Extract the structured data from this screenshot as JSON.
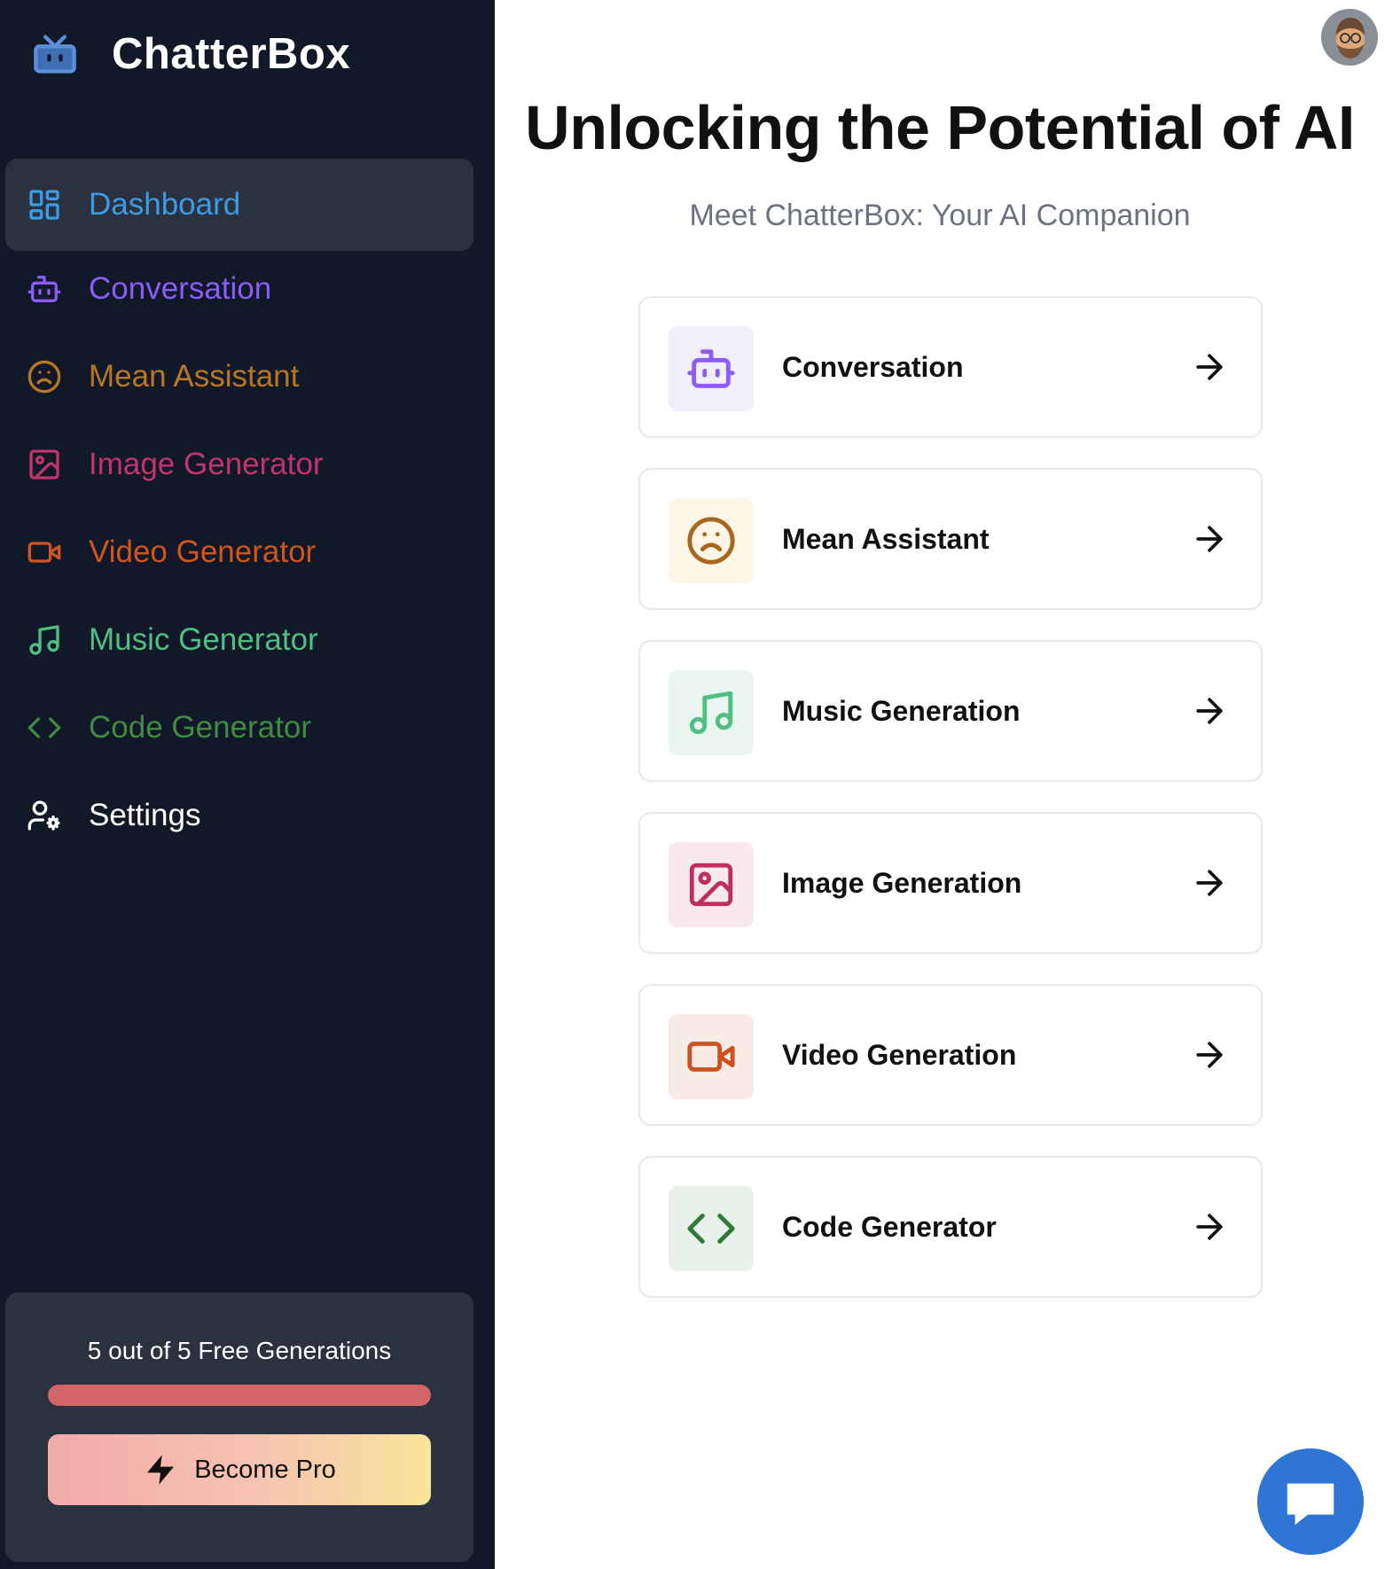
{
  "app": {
    "name": "ChatterBox"
  },
  "sidebar": {
    "items": [
      {
        "label": "Dashboard",
        "icon": "dashboard-icon",
        "color": "#3b9ce6",
        "active": true
      },
      {
        "label": "Conversation",
        "icon": "bot-icon",
        "color": "#8b5cf6"
      },
      {
        "label": "Mean Assistant",
        "icon": "frown-icon",
        "color": "#b87624"
      },
      {
        "label": "Image Generator",
        "icon": "image-icon",
        "color": "#c0356a"
      },
      {
        "label": "Video Generator",
        "icon": "video-icon",
        "color": "#d0551f"
      },
      {
        "label": "Music Generator",
        "icon": "music-icon",
        "color": "#4fbf82"
      },
      {
        "label": "Code Generator",
        "icon": "code-icon",
        "color": "#3f8a44"
      },
      {
        "label": "Settings",
        "icon": "settings-icon",
        "color": "#ffffff"
      }
    ]
  },
  "usage": {
    "text": "5 out of 5 Free Generations",
    "progress_percent": 100,
    "button_label": "Become Pro"
  },
  "main": {
    "title": "Unlocking the Potential of AI",
    "subtitle": "Meet ChatterBox: Your AI Companion",
    "cards": [
      {
        "label": "Conversation",
        "icon": "bot-icon",
        "color": "#8b5cf6",
        "bg": "#f2effd"
      },
      {
        "label": "Mean Assistant",
        "icon": "frown-icon",
        "color": "#a8671e",
        "bg": "#fdf5e6"
      },
      {
        "label": "Music Generation",
        "icon": "music-icon",
        "color": "#4fbf82",
        "bg": "#eaf7f0"
      },
      {
        "label": "Image Generation",
        "icon": "image-icon",
        "color": "#be2f5b",
        "bg": "#f9e9ee"
      },
      {
        "label": "Video Generation",
        "icon": "video-icon",
        "color": "#cc5020",
        "bg": "#f8ebe6"
      },
      {
        "label": "Code Generator",
        "icon": "code-icon",
        "color": "#2f7a39",
        "bg": "#e9f2ea"
      }
    ]
  },
  "colors": {
    "sidebar_bg": "#111827",
    "active_bg": "#2b313e",
    "chat_button": "#2f75d6"
  }
}
